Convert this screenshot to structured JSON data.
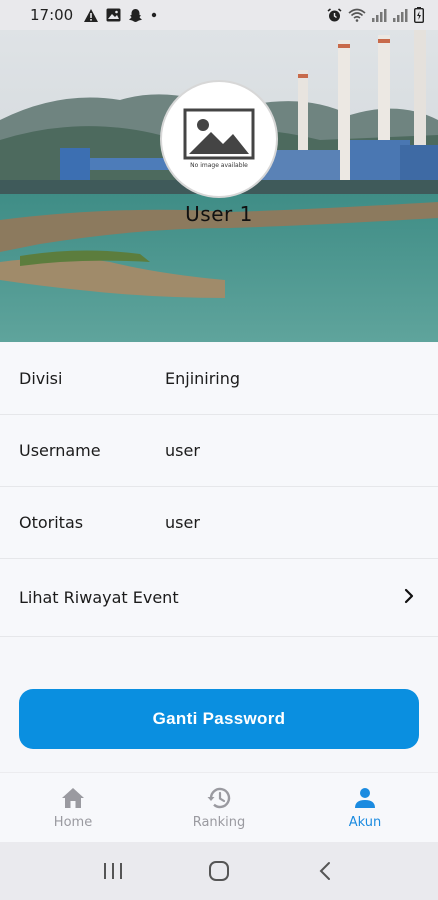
{
  "status_bar": {
    "time": "17:00",
    "left_icons": [
      "warning-icon",
      "image-icon",
      "snapchat-icon",
      "dot-icon"
    ],
    "right_icons": [
      "alarm-icon",
      "wifi-icon",
      "signal-icon",
      "signal-icon",
      "battery-icon"
    ]
  },
  "profile": {
    "avatar_caption": "No image available",
    "name": "User 1"
  },
  "info": {
    "division_label": "Divisi",
    "division_value": "Enjiniring",
    "username_label": "Username",
    "username_value": "user",
    "authority_label": "Otoritas",
    "authority_value": "user",
    "event_history_label": "Lihat Riwayat Event"
  },
  "actions": {
    "change_password": "Ganti Password"
  },
  "bottom_nav": {
    "items": [
      {
        "label": "Home",
        "icon": "home-icon",
        "active": false
      },
      {
        "label": "Ranking",
        "icon": "history-icon",
        "active": false
      },
      {
        "label": "Akun",
        "icon": "person-icon",
        "active": true
      }
    ],
    "active_color": "#1b8be0",
    "inactive_color": "#9a9aa0"
  },
  "colors": {
    "primary_button": "#0a8fe0"
  }
}
